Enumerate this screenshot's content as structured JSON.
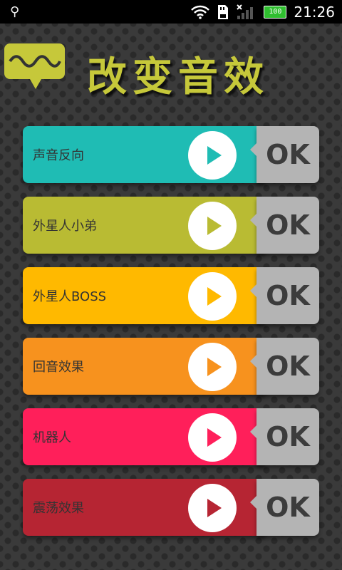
{
  "status_bar": {
    "time": "21:26",
    "battery": "100",
    "icons": [
      "usb-icon",
      "wifi-icon",
      "sd-card-icon",
      "signal-icon",
      "battery-icon"
    ]
  },
  "header": {
    "title": "改变音效",
    "icon": "sound-wave-speech-bubble-icon",
    "accent_color": "#c6c83a"
  },
  "effects": [
    {
      "label": "声音反向",
      "color": "#1fbcb4",
      "action": "OK"
    },
    {
      "label": "外星人小弟",
      "color": "#b9bb33",
      "action": "OK"
    },
    {
      "label": "外星人BOSS",
      "color": "#ffb900",
      "action": "OK"
    },
    {
      "label": "回音效果",
      "color": "#f7921e",
      "action": "OK"
    },
    {
      "label": "机器人",
      "color": "#ff1f5a",
      "action": "OK"
    },
    {
      "label": "震荡效果",
      "color": "#b62533",
      "action": "OK"
    }
  ]
}
